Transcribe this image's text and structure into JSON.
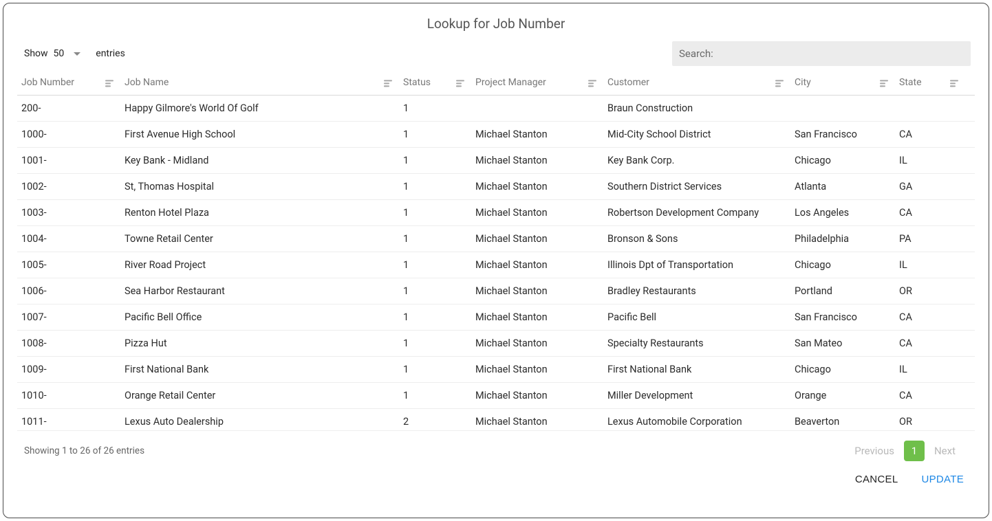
{
  "dialog": {
    "title": "Lookup for Job Number"
  },
  "lengthControl": {
    "show_label": "Show",
    "value": "50",
    "entries_label": "entries"
  },
  "search": {
    "label": "Search:"
  },
  "columns": [
    {
      "label": "Job Number"
    },
    {
      "label": "Job Name"
    },
    {
      "label": "Status"
    },
    {
      "label": "Project Manager"
    },
    {
      "label": "Customer"
    },
    {
      "label": "City"
    },
    {
      "label": "State"
    }
  ],
  "rows": [
    {
      "job_number": "200-",
      "job_name": "Happy Gilmore's World Of Golf",
      "status": "1",
      "pm": "",
      "customer": "Braun Construction",
      "city": "",
      "state": ""
    },
    {
      "job_number": "1000-",
      "job_name": "First Avenue High School",
      "status": "1",
      "pm": "Michael Stanton",
      "customer": "Mid-City School District",
      "city": "San Francisco",
      "state": "CA"
    },
    {
      "job_number": "1001-",
      "job_name": "Key Bank - Midland",
      "status": "1",
      "pm": "Michael Stanton",
      "customer": "Key Bank Corp.",
      "city": "Chicago",
      "state": "IL"
    },
    {
      "job_number": "1002-",
      "job_name": "St, Thomas Hospital",
      "status": "1",
      "pm": "Michael Stanton",
      "customer": "Southern District Services",
      "city": "Atlanta",
      "state": "GA"
    },
    {
      "job_number": "1003-",
      "job_name": "Renton Hotel Plaza",
      "status": "1",
      "pm": "Michael Stanton",
      "customer": "Robertson Development Company",
      "city": "Los Angeles",
      "state": "CA"
    },
    {
      "job_number": "1004-",
      "job_name": "Towne Retail Center",
      "status": "1",
      "pm": "Michael Stanton",
      "customer": "Bronson & Sons",
      "city": "Philadelphia",
      "state": "PA"
    },
    {
      "job_number": "1005-",
      "job_name": "River Road Project",
      "status": "1",
      "pm": "Michael Stanton",
      "customer": "Illinois Dpt of Transportation",
      "city": "Chicago",
      "state": "IL"
    },
    {
      "job_number": "1006-",
      "job_name": "Sea Harbor Restaurant",
      "status": "1",
      "pm": "Michael Stanton",
      "customer": "Bradley Restaurants",
      "city": "Portland",
      "state": "OR"
    },
    {
      "job_number": "1007-",
      "job_name": "Pacific Bell Office",
      "status": "1",
      "pm": "Michael Stanton",
      "customer": "Pacific Bell",
      "city": "San Francisco",
      "state": "CA"
    },
    {
      "job_number": "1008-",
      "job_name": "Pizza Hut",
      "status": "1",
      "pm": "Michael Stanton",
      "customer": "Specialty Restaurants",
      "city": "San Mateo",
      "state": "CA"
    },
    {
      "job_number": "1009-",
      "job_name": "First National Bank",
      "status": "1",
      "pm": "Michael Stanton",
      "customer": "First National Bank",
      "city": "Chicago",
      "state": "IL"
    },
    {
      "job_number": "1010-",
      "job_name": "Orange Retail Center",
      "status": "1",
      "pm": "Michael Stanton",
      "customer": "Miller Development",
      "city": "Orange",
      "state": "CA"
    },
    {
      "job_number": "1011-",
      "job_name": "Lexus Auto Dealership",
      "status": "2",
      "pm": "Michael Stanton",
      "customer": "Lexus Automobile Corporation",
      "city": "Beaverton",
      "state": "OR"
    }
  ],
  "footer": {
    "info": "Showing 1 to 26 of 26 entries",
    "previous": "Previous",
    "current_page": "1",
    "next": "Next"
  },
  "actions": {
    "cancel": "CANCEL",
    "update": "UPDATE"
  }
}
